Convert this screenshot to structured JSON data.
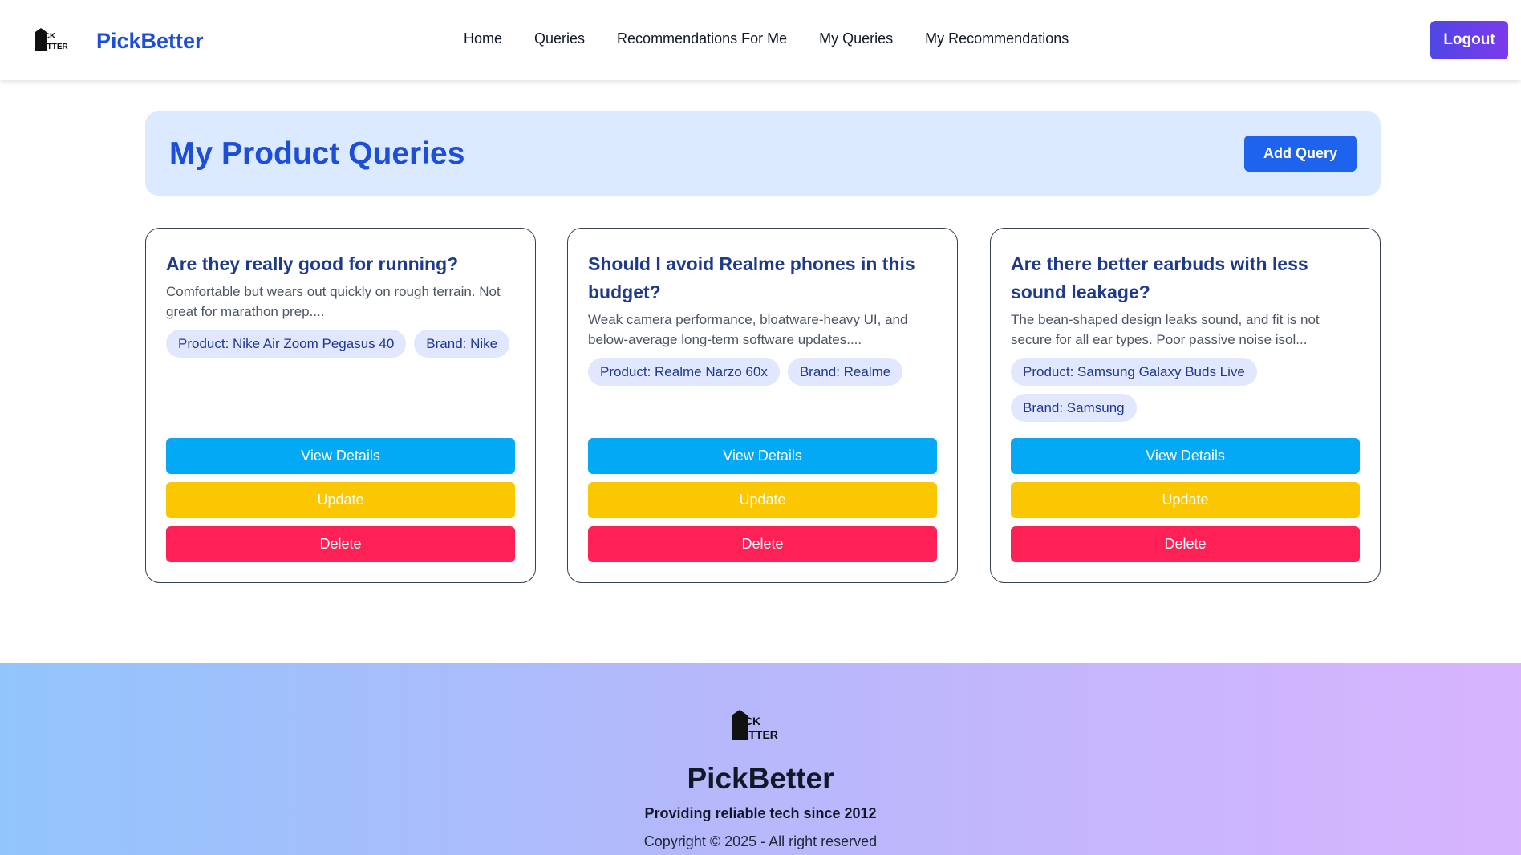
{
  "nav": {
    "brand": "PickBetter",
    "logo_text_top": "ICK",
    "logo_text_bottom": "ETTER",
    "links": [
      "Home",
      "Queries",
      "Recommendations For Me",
      "My Queries",
      "My Recommendations"
    ],
    "logout_label": "Logout"
  },
  "header": {
    "title": "My Product Queries",
    "add_label": "Add Query"
  },
  "cards": [
    {
      "title": "Are they really good for running?",
      "description": "Comfortable but wears out quickly on rough terrain. Not great for marathon prep....",
      "product_tag": "Product: Nike Air Zoom Pegasus 40",
      "brand_tag": "Brand: Nike",
      "view_label": "View Details",
      "update_label": "Update",
      "delete_label": "Delete"
    },
    {
      "title": "Should I avoid Realme phones in this budget?",
      "description": "Weak camera performance, bloatware-heavy UI, and below-average long-term software updates....",
      "product_tag": "Product: Realme Narzo 60x",
      "brand_tag": "Brand: Realme",
      "view_label": "View Details",
      "update_label": "Update",
      "delete_label": "Delete"
    },
    {
      "title": "Are there better earbuds with less sound leakage?",
      "description": "The bean-shaped design leaks sound, and fit is not secure for all ear types. Poor passive noise isol...",
      "product_tag": "Product: Samsung Galaxy Buds Live",
      "brand_tag": "Brand: Samsung",
      "view_label": "View Details",
      "update_label": "Update",
      "delete_label": "Delete"
    }
  ],
  "footer": {
    "brand": "PickBetter",
    "tagline": "Providing reliable tech since 2012",
    "copyright": "Copyright © 2025 - All right reserved"
  },
  "colors": {
    "brand_blue": "#1d4ed8",
    "title_navy": "#1e3a8a",
    "view_button": "#03a9f4",
    "update_button": "#fac700",
    "delete_button": "#ff2056",
    "banner_bg": "#dbeafe",
    "tag_bg": "#e0e7ff"
  }
}
